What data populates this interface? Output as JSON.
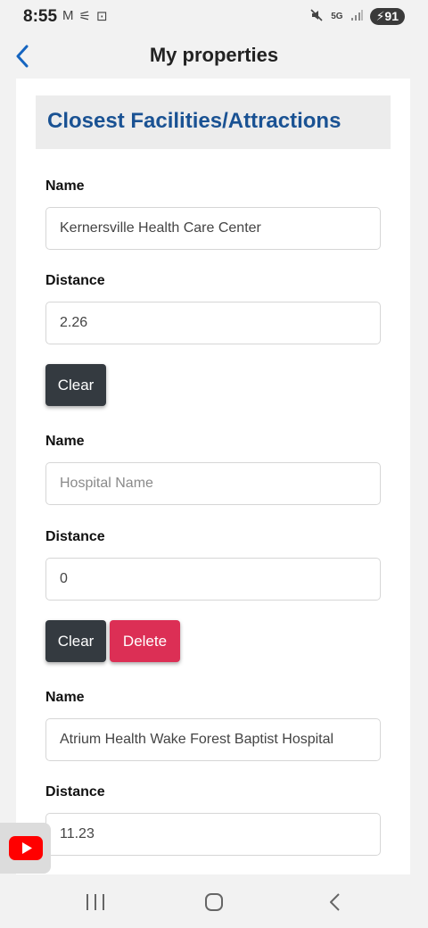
{
  "status_bar": {
    "time": "8:55",
    "battery": "91",
    "network": "5G"
  },
  "header": {
    "title": "My properties"
  },
  "section": {
    "title": "Closest Facilities/Attractions"
  },
  "facilities": [
    {
      "name_label": "Name",
      "name_value": "Kernersville Health Care Center",
      "name_placeholder": "Hospital Name",
      "distance_label": "Distance",
      "distance_value": "2.26",
      "clear_label": "Clear"
    },
    {
      "name_label": "Name",
      "name_value": "",
      "name_placeholder": "Hospital Name",
      "distance_label": "Distance",
      "distance_value": "0",
      "clear_label": "Clear",
      "delete_label": "Delete"
    },
    {
      "name_label": "Name",
      "name_value": "Atrium Health Wake Forest Baptist Hospital",
      "name_placeholder": "Hospital Name",
      "distance_label": "Distance",
      "distance_value": "11.23"
    }
  ],
  "colors": {
    "accent": "#1a5293",
    "clear_button": "#343a40",
    "delete_button": "#dc2f55"
  },
  "icons": [
    "back-chevron-icon",
    "youtube-icon",
    "recent-apps-icon",
    "home-icon",
    "nav-back-icon"
  ]
}
